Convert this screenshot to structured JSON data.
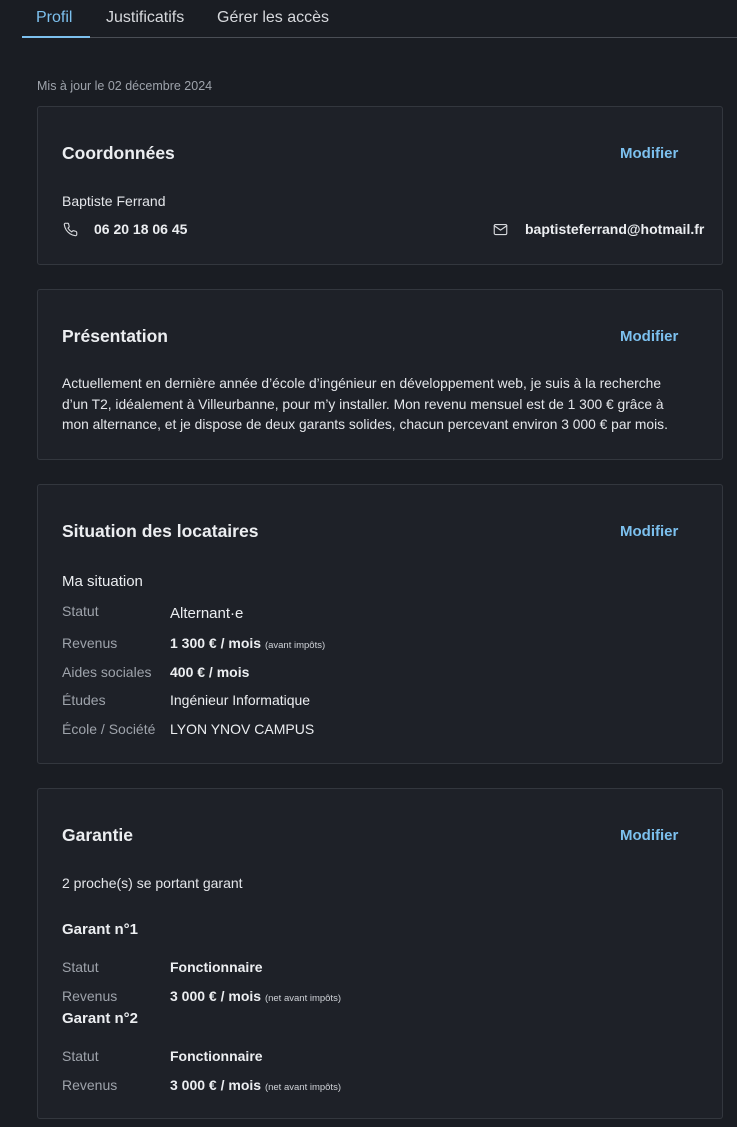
{
  "tabs": [
    {
      "label": "Profil",
      "active": true
    },
    {
      "label": "Justificatifs",
      "active": false
    },
    {
      "label": "Gérer les accès",
      "active": false
    }
  ],
  "updated": "Mis à jour le 02 décembre 2024",
  "modify_label": "Modifier",
  "coordonnees": {
    "title": "Coordonnées",
    "name": "Baptiste Ferrand",
    "phone": "06 20 18 06 45",
    "email": "baptisteferrand@hotmail.fr",
    "phone_icon": "phone-icon",
    "email_icon": "mail-icon"
  },
  "presentation": {
    "title": "Présentation",
    "lines": [
      "Actuellement en dernière année d’école d’ingénieur en développement web, je suis à la recherche",
      "d’un T2, idéalement à Villeurbanne, pour m’y installer. Mon revenu mensuel est de 1 300 € grâce à",
      "mon alternance, et je dispose de deux garants solides, chacun percevant environ 3 000 € par mois."
    ]
  },
  "situation": {
    "title": "Situation des locataires",
    "subtitle": "Ma situation",
    "rows": [
      {
        "label": "Statut",
        "value": "Alternant·e",
        "note": ""
      },
      {
        "label": "Revenus",
        "value": "1 300 € / mois",
        "note": "(avant impôts)"
      },
      {
        "label": "Aides sociales",
        "value": "400 € / mois",
        "note": ""
      },
      {
        "label": "Études",
        "value": "Ingénieur Informatique",
        "note": ""
      },
      {
        "label": "École / Société",
        "value": "LYON YNOV CAMPUS",
        "note": ""
      }
    ]
  },
  "garantie": {
    "title": "Garantie",
    "count_text": "2 proche(s) se portant garant",
    "garants": [
      {
        "title": "Garant n°1",
        "statut_label": "Statut",
        "statut": "Fonctionnaire",
        "revenus_label": "Revenus",
        "revenus": "3 000 € / mois",
        "note": "(net avant impôts)"
      },
      {
        "title": "Garant n°2",
        "statut_label": "Statut",
        "statut": "Fonctionnaire",
        "revenus_label": "Revenus",
        "revenus": "3 000 € / mois",
        "note": "(net avant impôts)"
      }
    ]
  },
  "colors": {
    "accent": "#7cc0ee",
    "background": "#1a1d23",
    "card": "#1e2128"
  }
}
